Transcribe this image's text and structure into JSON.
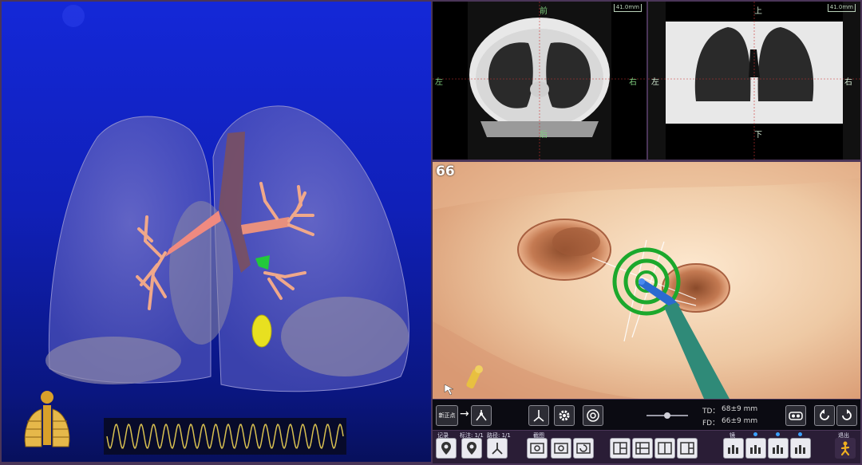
{
  "axial": {
    "top": "前",
    "bottom": "后",
    "left": "左",
    "right": "右",
    "scale": "41.0mm"
  },
  "coronal": {
    "top": "上",
    "bottom": "下",
    "left": "左",
    "right": "右",
    "scale": "41.0mm"
  },
  "endoscope": {
    "frame_number": "66"
  },
  "toolbar": {
    "new_point_label": "新正点",
    "td_label": "TD：",
    "td_value": "68±9 mm",
    "fd_label": "FD：",
    "fd_value": "66±9 mm"
  },
  "bottom_bar": {
    "labels": [
      "记录",
      "标注: 1/1",
      "路径: 1/1",
      "截图",
      "镜",
      "退出"
    ]
  },
  "colors": {
    "background_3d": "#1428d8",
    "target_ring": "#19b832",
    "probe": "#2f8a78",
    "lesion": "#e8e020"
  },
  "icons": {
    "new_point": "flag-pin-icon",
    "path": "route-icon",
    "settings": "gear-icon",
    "focus": "target-icon",
    "slider": "slider-icon",
    "vr": "vr-glasses-icon",
    "rotate_left": "rotate-ccw-icon",
    "rotate_right": "rotate-cw-icon"
  }
}
